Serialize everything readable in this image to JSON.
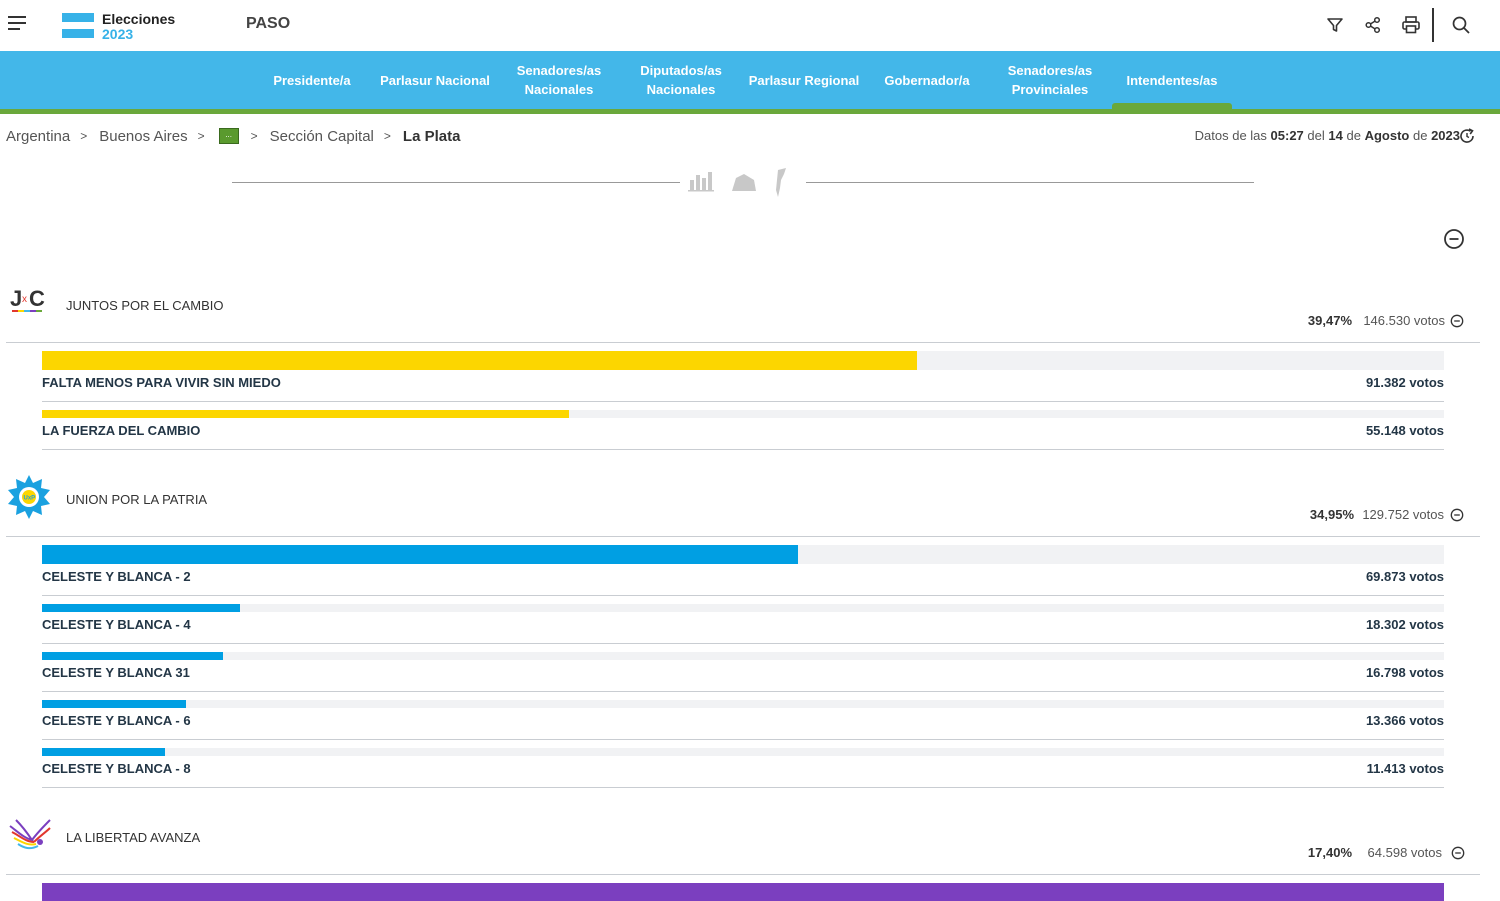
{
  "header": {
    "brand_title": "Elecciones",
    "brand_year": "2023",
    "election_type": "PASO",
    "tools": [
      "filter-icon",
      "share-icon",
      "print-icon",
      "search-icon"
    ]
  },
  "nav": {
    "items": [
      {
        "line1": "Presidente/a",
        "line2": ""
      },
      {
        "line1": "Parlasur Nacional",
        "line2": ""
      },
      {
        "line1": "Senadores/as",
        "line2": "Nacionales"
      },
      {
        "line1": "Diputados/as",
        "line2": "Nacionales"
      },
      {
        "line1": "Parlasur Regional",
        "line2": ""
      },
      {
        "line1": "Gobernador/a",
        "line2": ""
      },
      {
        "line1": "Senadores/as",
        "line2": "Provinciales"
      },
      {
        "line1": "Intendentes/as",
        "line2": ""
      }
    ],
    "active": "Intendentes/as",
    "colors": {
      "bar": "#43b7e9",
      "accent": "#6aa83b"
    }
  },
  "breadcrumb": {
    "items": [
      "Argentina",
      "Buenos Aires",
      "",
      "Sección Capital",
      "La Plata"
    ],
    "separator": ">",
    "badge": "..."
  },
  "updated": {
    "prefix": "Datos de las",
    "time": "05:27",
    "mid": "del",
    "day": "14",
    "mid2": "de",
    "month": "Agosto",
    "mid3": "de",
    "year": "2023"
  },
  "views": [
    "bar-chart-icon",
    "map-region-icon",
    "map-country-icon"
  ],
  "parties": [
    {
      "name": "JUNTOS POR EL CAMBIO",
      "logo": "JxC",
      "pct": "39,47%",
      "votes": "146.530 votos",
      "color": "#fcd600",
      "lists": [
        {
          "name": "FALTA MENOS PARA VIVIR SIN MIEDO",
          "votes": "91.382 votos",
          "share": 0.624
        },
        {
          "name": "LA FUERZA DEL CAMBIO",
          "votes": "55.148 votos",
          "share": 0.376
        }
      ]
    },
    {
      "name": "UNION POR LA PATRIA",
      "logo": "UxP",
      "pct": "34,95%",
      "votes": "129.752 votos",
      "color": "#009fe3",
      "lists": [
        {
          "name": "CELESTE Y BLANCA - 2",
          "votes": "69.873 votos",
          "share": 0.539
        },
        {
          "name": "CELESTE Y BLANCA - 4",
          "votes": "18.302 votos",
          "share": 0.141
        },
        {
          "name": "CELESTE Y BLANCA 31",
          "votes": "16.798 votos",
          "share": 0.129
        },
        {
          "name": "CELESTE Y BLANCA - 6",
          "votes": "13.366 votos",
          "share": 0.103
        },
        {
          "name": "CELESTE Y BLANCA - 8",
          "votes": "11.413 votos",
          "share": 0.088
        }
      ]
    },
    {
      "name": "LA LIBERTAD AVANZA",
      "logo": "LLA",
      "pct": "17,40%",
      "votes": "64.598 votos",
      "color": "#7b3fbf",
      "lists": [
        {
          "name": "",
          "votes": "",
          "share": 1.0
        }
      ]
    }
  ]
}
